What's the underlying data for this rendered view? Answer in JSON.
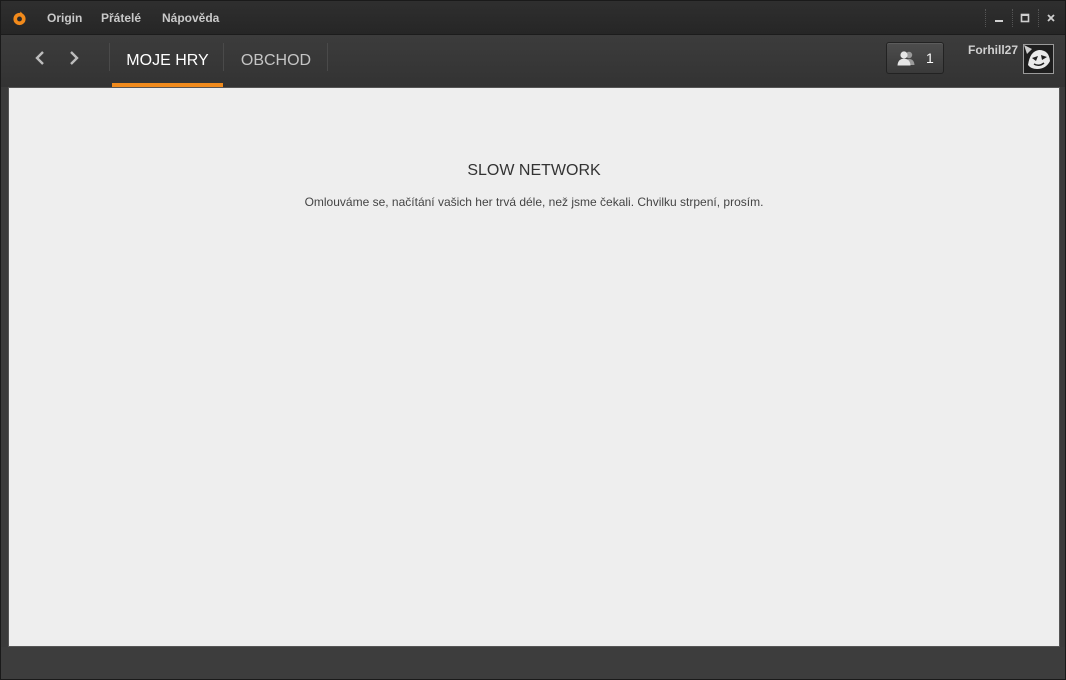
{
  "menu": {
    "items": [
      "Origin",
      "Přátelé",
      "Nápověda"
    ]
  },
  "window_controls": {
    "minimize": "–",
    "maximize": "□",
    "close": "×"
  },
  "nav": {
    "back_icon": "chevron-left-icon",
    "forward_icon": "chevron-right-icon",
    "tabs": [
      {
        "label": "MOJE HRY",
        "active": true
      },
      {
        "label": "OBCHOD",
        "active": false
      }
    ],
    "friends_count": "1",
    "username": "Forhill27"
  },
  "content": {
    "title": "SLOW NETWORK",
    "message": "Omlouváme se, načítání vašich her trvá déle, než jsme čekali. Chvilku strpení, prosím."
  },
  "colors": {
    "accent": "#f08a1c",
    "chrome": "#3b3b3b",
    "content_bg": "#eeeeee"
  }
}
